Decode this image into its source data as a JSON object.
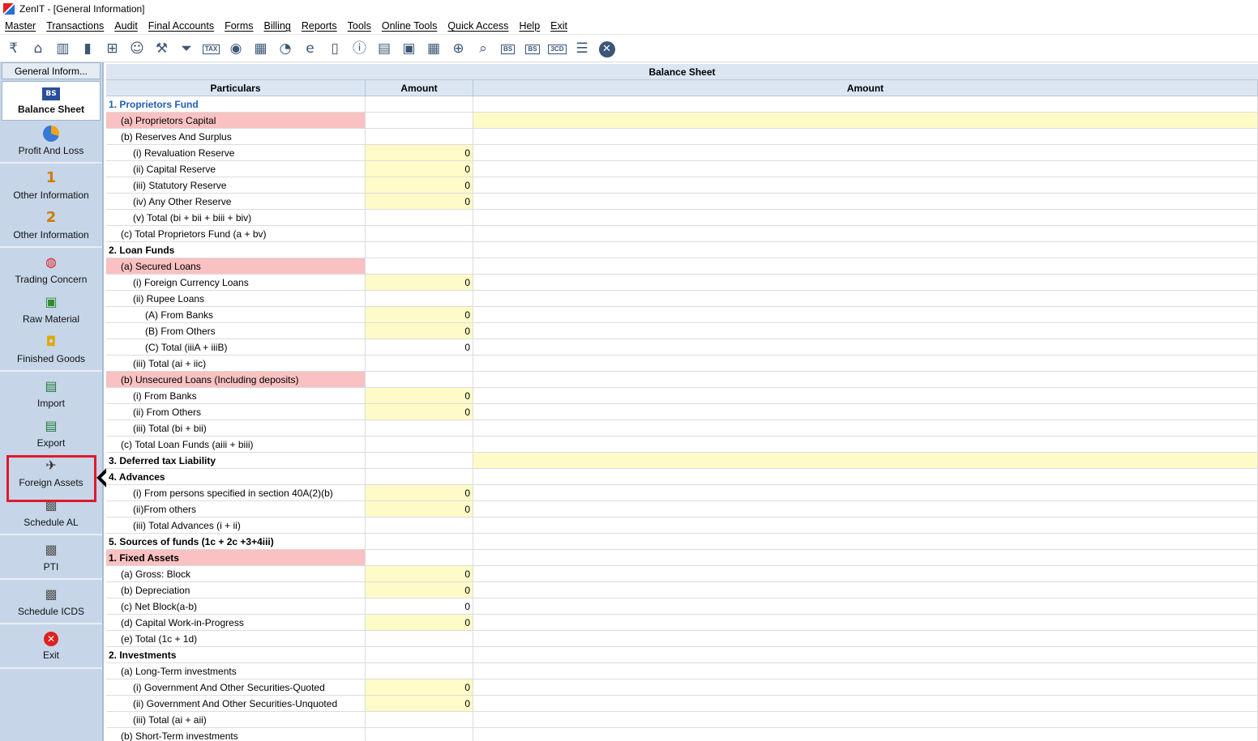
{
  "window": {
    "title": "ZenIT - [General Information]"
  },
  "menu": [
    "Master",
    "Transactions",
    "Audit",
    "Final Accounts",
    "Forms",
    "Billing",
    "Reports",
    "Tools",
    "Online Tools",
    "Quick Access",
    "Help",
    "Exit"
  ],
  "toolbar_icons": [
    {
      "name": "rupee-doc-icon",
      "glyph": "₹"
    },
    {
      "name": "home-icon",
      "glyph": "⌂"
    },
    {
      "name": "building-icon",
      "glyph": "▥"
    },
    {
      "name": "bar-chart-icon",
      "glyph": "▮"
    },
    {
      "name": "gift-icon",
      "glyph": "⊞"
    },
    {
      "name": "group-icon",
      "glyph": "☺"
    },
    {
      "name": "hammer-icon",
      "glyph": "⚒"
    },
    {
      "name": "filter-icon",
      "glyph": "⏷"
    },
    {
      "name": "tax-icon",
      "text": "TAX"
    },
    {
      "name": "coin-icon",
      "glyph": "◉"
    },
    {
      "name": "calculator-icon",
      "glyph": "▦"
    },
    {
      "name": "pie-icon",
      "glyph": "◔"
    },
    {
      "name": "epay-icon",
      "glyph": "e"
    },
    {
      "name": "book-icon",
      "glyph": "▯"
    },
    {
      "name": "info-icon",
      "glyph": "ⓘ"
    },
    {
      "name": "report-icon",
      "glyph": "▤"
    },
    {
      "name": "user-doc-icon",
      "glyph": "▣"
    },
    {
      "name": "calendar-icon",
      "glyph": "▦"
    },
    {
      "name": "add-doc-icon",
      "glyph": "⊕"
    },
    {
      "name": "search-doc-icon",
      "glyph": "⌕"
    },
    {
      "name": "bs-icon",
      "text": "BS"
    },
    {
      "name": "bs-sch-icon",
      "text": "BS"
    },
    {
      "name": "3cd-icon",
      "text": "3CD"
    },
    {
      "name": "list-icon",
      "glyph": "☰"
    },
    {
      "name": "close-icon",
      "glyph": "✕"
    }
  ],
  "sidebar": {
    "header": "General Inform...",
    "groups": [
      [
        {
          "label": "Balance Sheet",
          "icon": "bs",
          "active": true
        },
        {
          "label": "Profit And Loss",
          "icon": "pl"
        }
      ],
      [
        {
          "label": "Other Information",
          "icon": "num",
          "num": "1"
        },
        {
          "label": "Other Information",
          "icon": "num",
          "num": "2"
        }
      ],
      [
        {
          "label": "Trading Concern",
          "icon": "globe"
        },
        {
          "label": "Raw Material",
          "icon": "box"
        },
        {
          "label": "Finished Goods",
          "icon": "bag"
        }
      ],
      [
        {
          "label": "Import",
          "icon": "xl"
        },
        {
          "label": "Export",
          "icon": "xl"
        },
        {
          "label": "Foreign Assets",
          "icon": "plane"
        },
        {
          "label": "Schedule AL",
          "icon": "money"
        }
      ],
      [
        {
          "label": "PTI",
          "icon": "money"
        }
      ],
      [
        {
          "label": "Schedule ICDS",
          "icon": "money"
        }
      ],
      [
        {
          "label": "Exit",
          "icon": "exit"
        }
      ]
    ]
  },
  "grid": {
    "title": "Balance Sheet",
    "columns": [
      "Particulars",
      "Amount",
      "Amount"
    ],
    "rows": [
      {
        "label": "1. Proprietors Fund",
        "lvl": 0,
        "bold": true,
        "blue": true,
        "value": ""
      },
      {
        "label": "(a) Proprietors Capital",
        "lvl": 1,
        "pink": true,
        "value": "",
        "yc": true
      },
      {
        "label": "(b) Reserves And Surplus",
        "lvl": 1,
        "value": ""
      },
      {
        "label": "(i) Revaluation Reserve",
        "lvl": 2,
        "value": "0",
        "yb": true
      },
      {
        "label": "(ii) Capital Reserve",
        "lvl": 2,
        "value": "0",
        "yb": true
      },
      {
        "label": "(iii) Statutory Reserve",
        "lvl": 2,
        "value": "0",
        "yb": true
      },
      {
        "label": "(iv) Any Other Reserve",
        "lvl": 2,
        "value": "0",
        "yb": true
      },
      {
        "label": "(v) Total (bi + bii + biii + biv)",
        "lvl": 2,
        "value": ""
      },
      {
        "label": "(c) Total Proprietors Fund (a + bv)",
        "lvl": 1,
        "value": ""
      },
      {
        "label": "2. Loan Funds",
        "lvl": 0,
        "bold": true,
        "value": ""
      },
      {
        "label": "(a) Secured Loans",
        "lvl": 1,
        "pink": true,
        "value": ""
      },
      {
        "label": "(i) Foreign Currency Loans",
        "lvl": 2,
        "value": "0",
        "yb": true
      },
      {
        "label": "(ii) Rupee Loans",
        "lvl": 2,
        "value": ""
      },
      {
        "label": "(A) From Banks",
        "lvl": 3,
        "value": "0",
        "yb": true
      },
      {
        "label": "(B) From Others",
        "lvl": 3,
        "value": "0",
        "yb": true
      },
      {
        "label": "(C) Total (iiiA + iiiB)",
        "lvl": 3,
        "value": "0"
      },
      {
        "label": "(iii) Total (ai + iic)",
        "lvl": 2,
        "value": ""
      },
      {
        "label": "(b) Unsecured Loans (Including deposits)",
        "lvl": 1,
        "pink": true,
        "value": ""
      },
      {
        "label": "(i) From Banks",
        "lvl": 2,
        "value": "0",
        "yb": true
      },
      {
        "label": "(ii) From Others",
        "lvl": 2,
        "value": "0",
        "yb": true
      },
      {
        "label": "(iii) Total (bi + bii)",
        "lvl": 2,
        "value": ""
      },
      {
        "label": "(c) Total Loan Funds (aiii + biii)",
        "lvl": 1,
        "value": ""
      },
      {
        "label": "3. Deferred tax Liability",
        "lvl": 0,
        "bold": true,
        "value": "",
        "yc": true
      },
      {
        "label": "4. Advances",
        "lvl": 0,
        "bold": true,
        "value": ""
      },
      {
        "label": "(i) From persons specified in section 40A(2)(b)",
        "lvl": 2,
        "value": "0",
        "yb": true
      },
      {
        "label": "(ii)From others",
        "lvl": 2,
        "value": "0",
        "yb": true
      },
      {
        "label": "(iii) Total Advances (i + ii)",
        "lvl": 2,
        "value": ""
      },
      {
        "label": "5. Sources of funds (1c + 2c +3+4iii)",
        "lvl": 0,
        "bold": true,
        "value": ""
      },
      {
        "label": "1. Fixed Assets",
        "lvl": 0,
        "bold": true,
        "pink": true,
        "value": ""
      },
      {
        "label": "(a) Gross: Block",
        "lvl": 1,
        "value": "0",
        "yb": true
      },
      {
        "label": "(b) Depreciation",
        "lvl": 1,
        "value": "0",
        "yb": true
      },
      {
        "label": "(c) Net Block(a-b)",
        "lvl": 1,
        "value": "0"
      },
      {
        "label": "(d) Capital Work-in-Progress",
        "lvl": 1,
        "value": "0",
        "yb": true
      },
      {
        "label": "(e) Total (1c + 1d)",
        "lvl": 1,
        "value": ""
      },
      {
        "label": "2. Investments",
        "lvl": 0,
        "bold": true,
        "value": ""
      },
      {
        "label": "(a) Long-Term investments",
        "lvl": 1,
        "value": ""
      },
      {
        "label": "(i) Government And Other Securities-Quoted",
        "lvl": 2,
        "value": "0",
        "yb": true
      },
      {
        "label": "(ii) Government And Other Securities-Unquoted",
        "lvl": 2,
        "value": "0",
        "yb": true
      },
      {
        "label": "(iii) Total (ai + aii)",
        "lvl": 2,
        "value": ""
      },
      {
        "label": "(b) Short-Term investments",
        "lvl": 1,
        "value": ""
      }
    ]
  }
}
